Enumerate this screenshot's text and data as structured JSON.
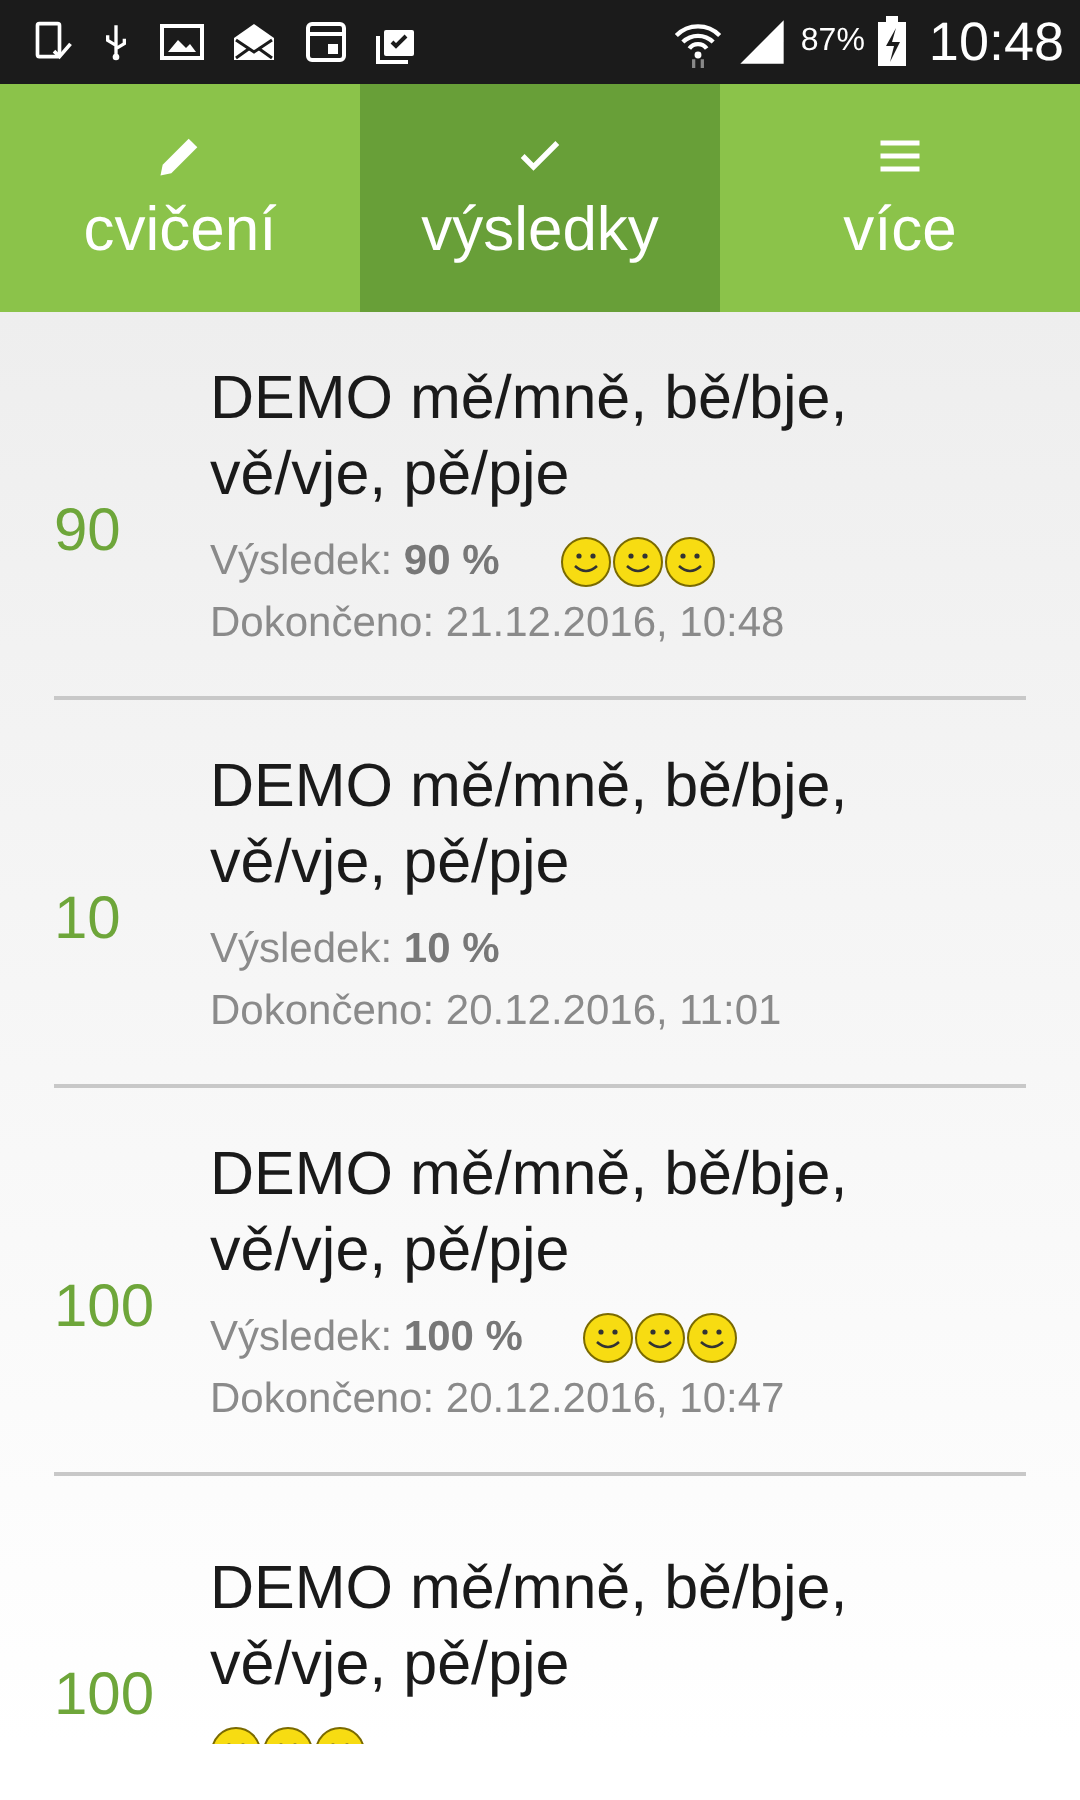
{
  "status_bar": {
    "battery": "87%",
    "time": "10:48"
  },
  "tabs": [
    {
      "label": "cvičení",
      "selected": false
    },
    {
      "label": "výsledky",
      "selected": true
    },
    {
      "label": "více",
      "selected": false
    }
  ],
  "results": [
    {
      "score": "90",
      "title": "DEMO mě/mně, bě/bje, vě/vje, pě/pje",
      "result_label": "Výsledek:",
      "result_value": "90 %",
      "stars": 3,
      "completed": "Dokončeno: 21.12.2016, 10:48"
    },
    {
      "score": "10",
      "title": "DEMO mě/mně, bě/bje, vě/vje, pě/pje",
      "result_label": "Výsledek:",
      "result_value": "10 %",
      "completed": "Dokončeno: 20.12.2016, 11:01"
    },
    {
      "score": "100",
      "title": "DEMO mě/mně, bě/bje, vě/vje, pě/pje",
      "result_label": "Výsledek:",
      "result_value": "100 %",
      "stars": 3,
      "completed": "Dokončeno: 20.12.2016, 10:47"
    },
    {
      "score": "100",
      "title": "DEMO mě/mně, bě/bje, vě/vje, pě/pje",
      "stars": 3
    }
  ]
}
